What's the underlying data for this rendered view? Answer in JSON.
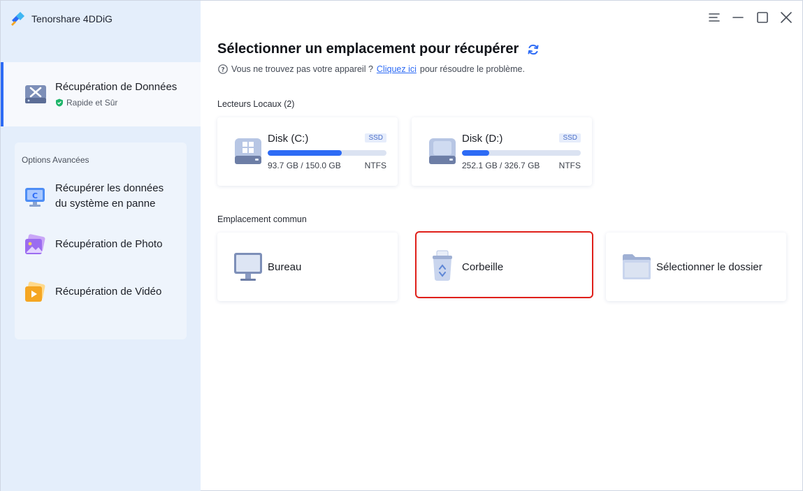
{
  "app": {
    "brand_name": "Tenorshare 4DDiG"
  },
  "sidebar": {
    "main_item": {
      "title": "Récupération de Données",
      "subtitle": "Rapide et Sûr"
    },
    "advanced": {
      "title": "Options Avancées",
      "items": [
        {
          "label_line1": "Récupérer les données",
          "label_line2": "du système en panne"
        },
        {
          "label": "Récupération de Photo"
        },
        {
          "label": "Récupération de Vidéo"
        }
      ]
    }
  },
  "main": {
    "title": "Sélectionner un emplacement pour récupérer",
    "hint_before": "Vous ne trouvez pas votre appareil ?",
    "hint_link": "Cliquez ici",
    "hint_after": "pour résoudre le problème.",
    "local_drives_label": "Lecteurs Locaux (2)",
    "drives": [
      {
        "name": "Disk (C:)",
        "badge": "SSD",
        "size": "93.7 GB / 150.0 GB",
        "fs": "NTFS",
        "used_fraction": 0.625
      },
      {
        "name": "Disk (D:)",
        "badge": "SSD",
        "size": "252.1 GB / 326.7 GB",
        "fs": "NTFS",
        "used_fraction": 0.23
      }
    ],
    "common_label": "Emplacement commun",
    "locations": [
      {
        "label": "Bureau"
      },
      {
        "label": "Corbeille"
      },
      {
        "label": "Sélectionner le dossier"
      }
    ]
  },
  "colors": {
    "accent": "#2d6bf5",
    "sidebar_bg": "#e4eefb",
    "selection_outline": "#e0201a"
  }
}
